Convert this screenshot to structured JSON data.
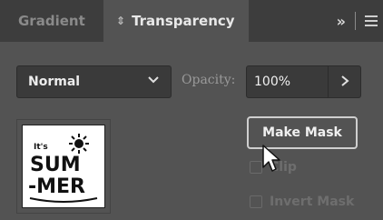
{
  "tabs": {
    "gradient": "Gradient",
    "transparency": "Transparency",
    "arrows_icon": "⇕",
    "overflow": "»"
  },
  "blend_mode": {
    "selected": "Normal"
  },
  "opacity": {
    "label": "Opacity:",
    "value": "100%"
  },
  "thumbnail": {
    "logo_text": "It's SUMMER"
  },
  "buttons": {
    "make_mask": "Make Mask"
  },
  "options": {
    "clip": "Clip",
    "invert_mask": "Invert Mask"
  },
  "icons": {
    "panel_menu": "hamburger-menu-icon",
    "dropdown": "chevron-down-icon",
    "opacity_arrow": "chevron-right-icon",
    "cursor": "mouse-pointer-icon"
  },
  "colors": {
    "panel_bg": "#535353",
    "tabbar_bg": "#3d3d3d",
    "field_bg": "#3a3a3a"
  }
}
